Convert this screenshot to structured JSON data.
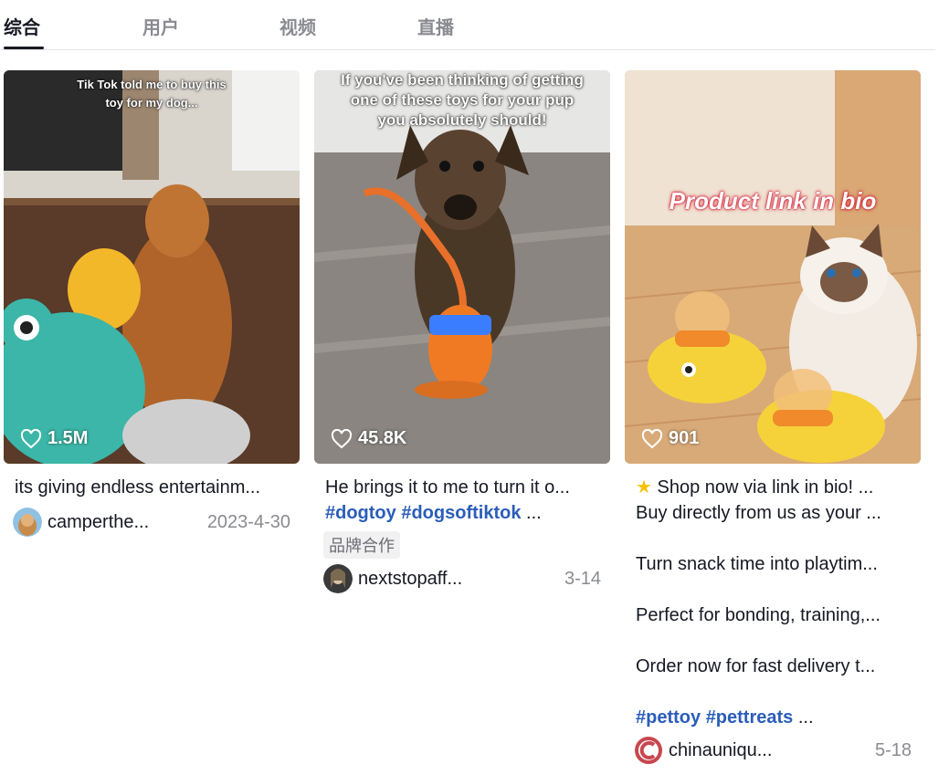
{
  "tabs": [
    {
      "label": "综合",
      "active": true
    },
    {
      "label": "用户",
      "active": false
    },
    {
      "label": "视频",
      "active": false
    },
    {
      "label": "直播",
      "active": false
    }
  ],
  "cards": [
    {
      "overlay_lines": [
        "Tik Tok told me to buy this",
        "toy for my dog..."
      ],
      "likes": "1.5M",
      "description": "its giving endless entertainm...",
      "author": "camperthe...",
      "date": "2023-4-30"
    },
    {
      "overlay_lines": [
        "If you've been thinking of getting",
        "one of these toys for your pup",
        "you absolutely should!"
      ],
      "likes": "45.8K",
      "description": "He brings it to me to turn it o...",
      "hashtags": [
        "#dogtoy",
        "#dogsoftiktok"
      ],
      "hashtags_more": "...",
      "badge": "品牌合作",
      "author": "nextstopaff...",
      "date": "3-14"
    },
    {
      "overlay_lines": [
        "Product link in bio"
      ],
      "likes": "901",
      "description_lines": [
        "Shop now via link in bio! ...",
        "Buy directly from us as your ...",
        "",
        "Turn snack time into playtim...",
        "",
        "Perfect for bonding, training,...",
        "",
        "Order now for fast delivery t...",
        ""
      ],
      "star_icon": "star-icon",
      "hashtags": [
        "#pettoy",
        "#pettreats"
      ],
      "hashtags_more": "...",
      "author": "chinauniqu...",
      "date": "5-18"
    }
  ],
  "colors": {
    "hashtag": "#2b5db9",
    "muted": "#8a8b91",
    "text": "#161823"
  }
}
